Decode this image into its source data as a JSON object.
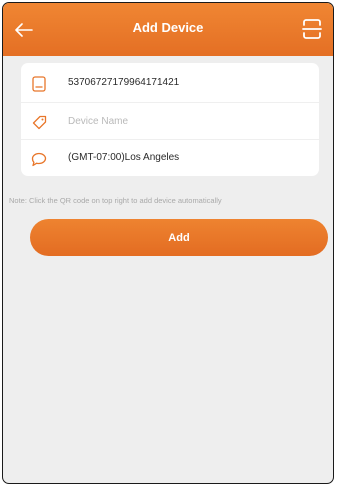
{
  "colors": {
    "header_bg": "#e97a2b",
    "accent": "#e8762a",
    "page_bg": "#eeeeee",
    "card_bg": "#ffffff"
  },
  "header": {
    "title": "Add Device",
    "back_icon": "arrow-left-icon",
    "right_icon": "qr-scan-icon"
  },
  "form": {
    "device_id": {
      "icon": "id-card-icon",
      "value": "53706727179964171421"
    },
    "device_name": {
      "icon": "tag-icon",
      "value": "",
      "placeholder": "Device Name"
    },
    "timezone": {
      "icon": "chat-bubble-icon",
      "value": "(GMT-07:00)Los Angeles"
    }
  },
  "note": "Note: Click the QR code on top right to add device automatically",
  "add_button": {
    "label": "Add"
  }
}
